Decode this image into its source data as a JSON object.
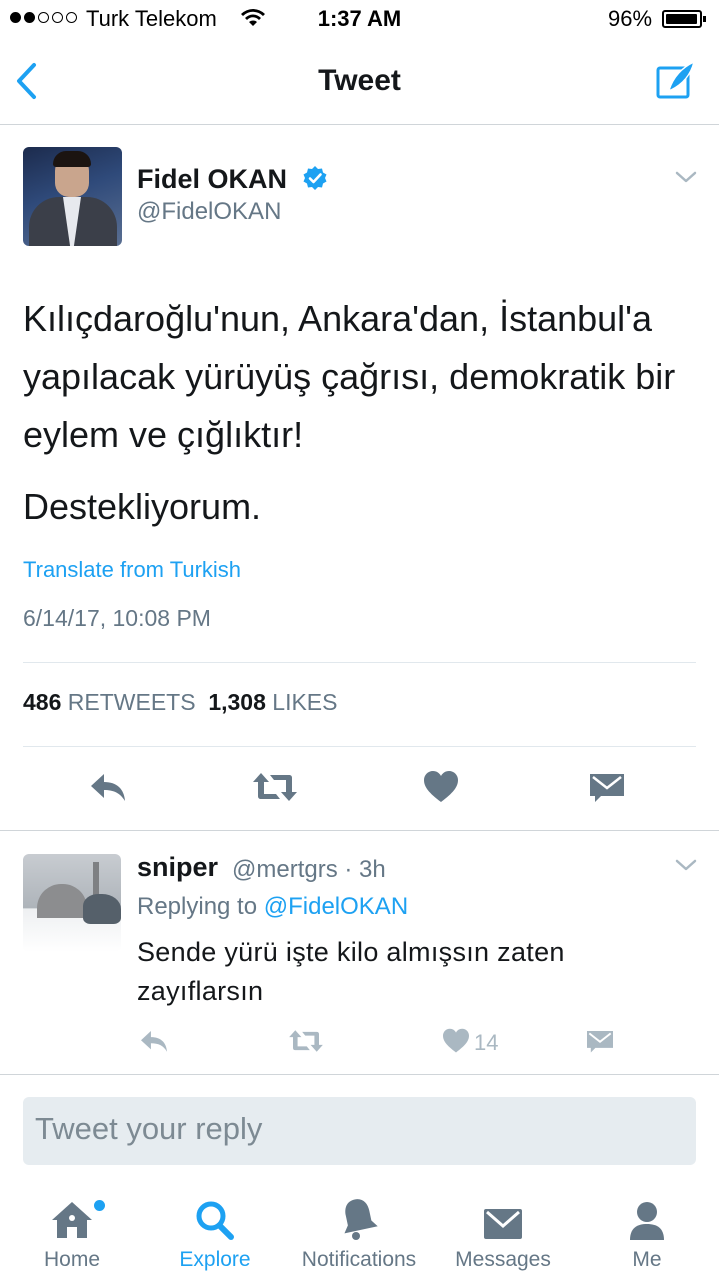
{
  "status_bar": {
    "carrier": "Turk Telekom",
    "time": "1:37 AM",
    "battery": "96%"
  },
  "nav": {
    "title": "Tweet"
  },
  "tweet": {
    "author_name": "Fidel OKAN",
    "author_handle": "@FidelOKAN",
    "paragraph_1": "Kılıçdaroğlu'nun, Ankara'dan, İstanbul'a yapılacak yürüyüş çağrısı, demokratik bir eylem ve çığlıktır!",
    "paragraph_2": "Destekliyorum.",
    "translate_label": "Translate from Turkish",
    "date": "6/14/17, 10:08 PM",
    "retweets_count": "486",
    "retweets_label": "RETWEETS",
    "likes_count": "1,308",
    "likes_label": "LIKES"
  },
  "reply": {
    "author_name": "sniper",
    "meta": "@mertgrs · 3h",
    "replying_label": "Replying to",
    "replying_handle": "@FidelOKAN",
    "text": "Sende yürü işte kilo almışsın zaten zayıflarsın",
    "like_count": "14"
  },
  "composer": {
    "placeholder": "Tweet your reply"
  },
  "tabs": [
    {
      "label": "Home",
      "icon": "home-icon"
    },
    {
      "label": "Explore",
      "icon": "search-icon"
    },
    {
      "label": "Notifications",
      "icon": "bell-icon"
    },
    {
      "label": "Messages",
      "icon": "envelope-icon"
    },
    {
      "label": "Me",
      "icon": "person-icon"
    }
  ],
  "colors": {
    "accent": "#1da1f2",
    "secondary_text": "#657786",
    "icon_gray": "#657786",
    "muted_icon": "#aab8c2"
  }
}
